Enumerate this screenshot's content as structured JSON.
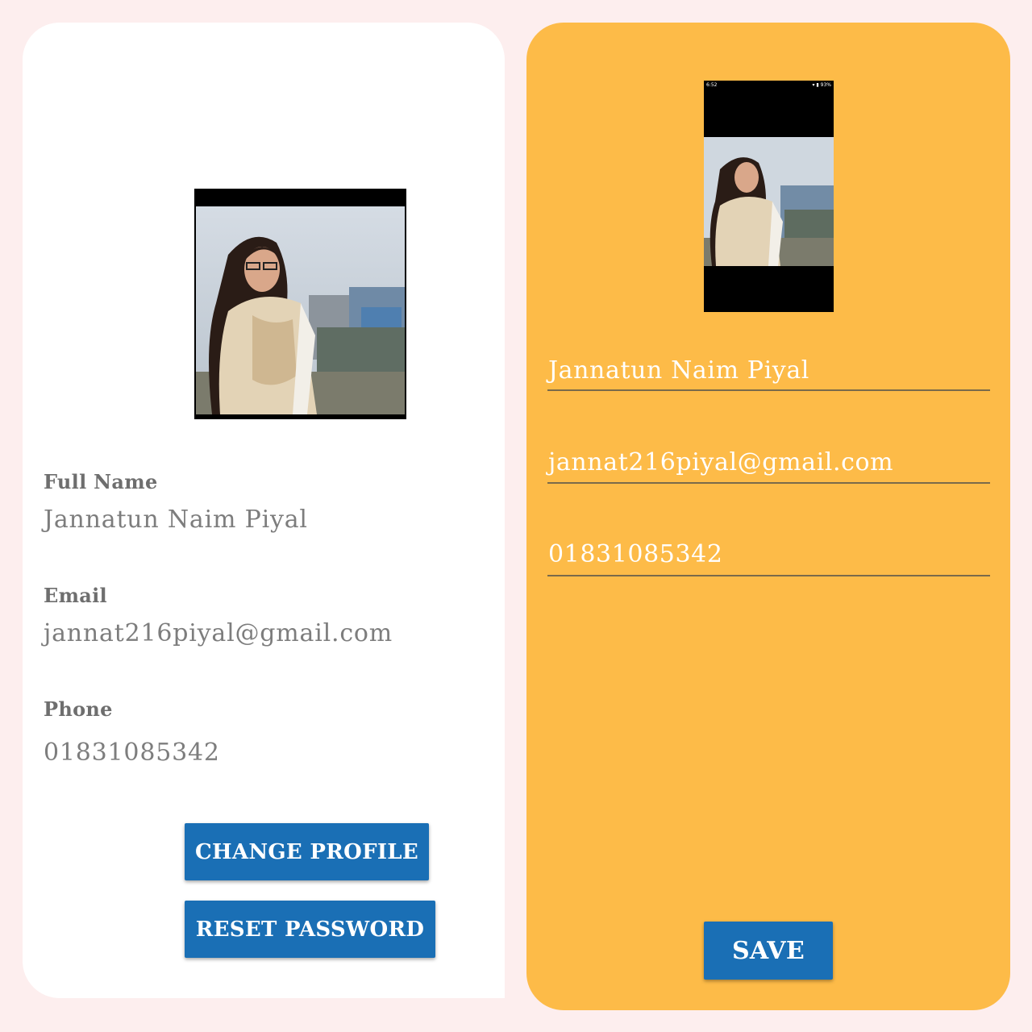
{
  "view_profile": {
    "full_name_label": "Full Name",
    "full_name_value": "Jannatun Naim Piyal",
    "email_label": "Email",
    "email_value": "jannat216piyal@gmail.com",
    "phone_label": "Phone",
    "phone_value": "01831085342",
    "change_profile_label": "CHANGE PROFILE",
    "reset_password_label": "RESET PASSWORD"
  },
  "edit_profile": {
    "status_time": "6:52",
    "status_battery": "93%",
    "name_input_value": "Jannatun Naim Piyal",
    "email_input_value": "jannat216piyal@gmail.com",
    "phone_input_value": "01831085342",
    "save_label": "SAVE"
  },
  "colors": {
    "page_background": "#fdeeee",
    "left_card": "#ffffff",
    "right_card": "#fdbb48",
    "button": "#1a6fb5",
    "button_text": "#ffffff"
  },
  "icons": {
    "status_bar_icons": [
      "wifi-icon",
      "signal-icon",
      "battery-icon"
    ]
  }
}
